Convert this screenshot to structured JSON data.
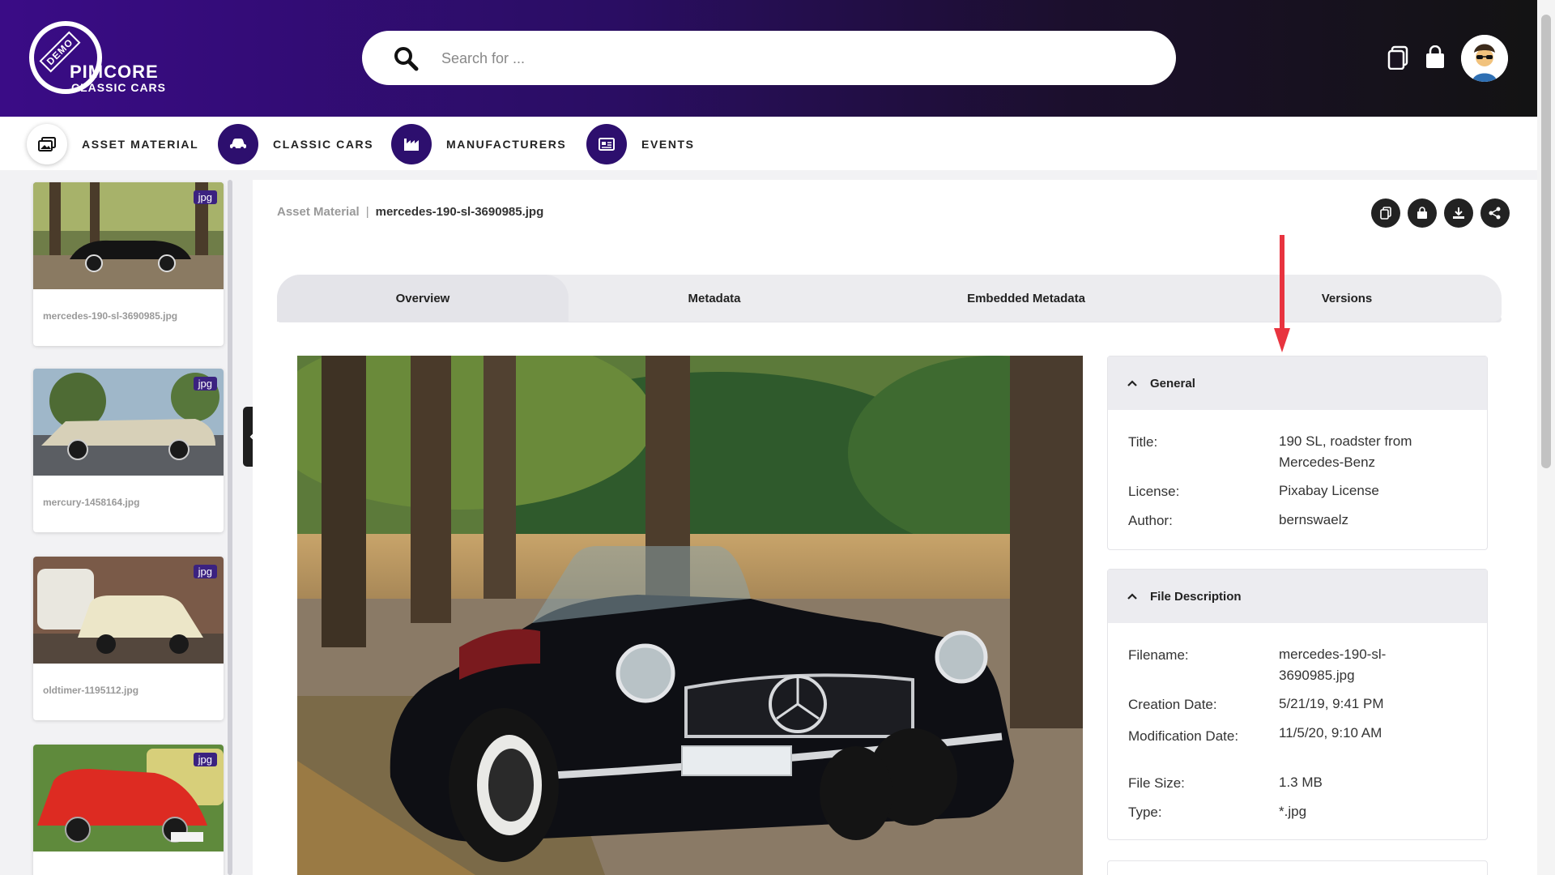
{
  "app": {
    "logo_badge": "DEMO",
    "logo_brand": "PIMCORE",
    "logo_subtitle": "CLASSIC CARS"
  },
  "search": {
    "placeholder": "Search for ..."
  },
  "header_icons": [
    "copy-icon",
    "shopping-bag-icon",
    "avatar"
  ],
  "nav": {
    "items": [
      {
        "label": "ASSET MATERIAL",
        "icon": "images-icon",
        "active": true
      },
      {
        "label": "CLASSIC CARS",
        "icon": "car-icon",
        "active": false
      },
      {
        "label": "MANUFACTURERS",
        "icon": "factory-icon",
        "active": false
      },
      {
        "label": "EVENTS",
        "icon": "calendar-icon",
        "active": false
      }
    ]
  },
  "sidebar": {
    "cards": [
      {
        "name": "mercedes-190-sl-3690985.jpg",
        "badge": "jpg"
      },
      {
        "name": "mercury-1458164.jpg",
        "badge": "jpg"
      },
      {
        "name": "oldtimer-1195112.jpg",
        "badge": "jpg"
      },
      {
        "name": "",
        "badge": "jpg"
      }
    ]
  },
  "breadcrumb": {
    "root": "Asset Material",
    "separator": "|",
    "current": "mercedes-190-sl-3690985.jpg"
  },
  "actions": [
    "copy-icon",
    "shopping-bag-icon",
    "download-icon",
    "share-icon"
  ],
  "tabs": [
    {
      "label": "Overview",
      "active": true
    },
    {
      "label": "Metadata",
      "active": false
    },
    {
      "label": "Embedded Metadata",
      "active": false
    },
    {
      "label": "Versions",
      "active": false
    }
  ],
  "general": {
    "title": "General",
    "rows": [
      {
        "label": "Title:",
        "value": "190 SL, roadster from Mercedes-Benz"
      },
      {
        "label": "License:",
        "value": "Pixabay License"
      },
      {
        "label": "Author:",
        "value": "bernswaelz"
      }
    ]
  },
  "file_description": {
    "title": "File Description",
    "rows": [
      {
        "label": "Filename:",
        "value": "mercedes-190-sl-3690985.jpg"
      },
      {
        "label": "Creation Date:",
        "value": "5/21/19, 9:41 PM"
      },
      {
        "label": "Modification Date:",
        "value": "11/5/20, 9:10 AM"
      },
      {
        "label": "File Size:",
        "value": "1.3 MB"
      },
      {
        "label": "Type:",
        "value": "*.jpg"
      }
    ]
  },
  "colors": {
    "header_start": "#3a0c86",
    "header_end": "#131313",
    "nav_icon_bg": "#2d0f6e",
    "badge": "#3b2280",
    "annotation_arrow": "#e8343f"
  }
}
